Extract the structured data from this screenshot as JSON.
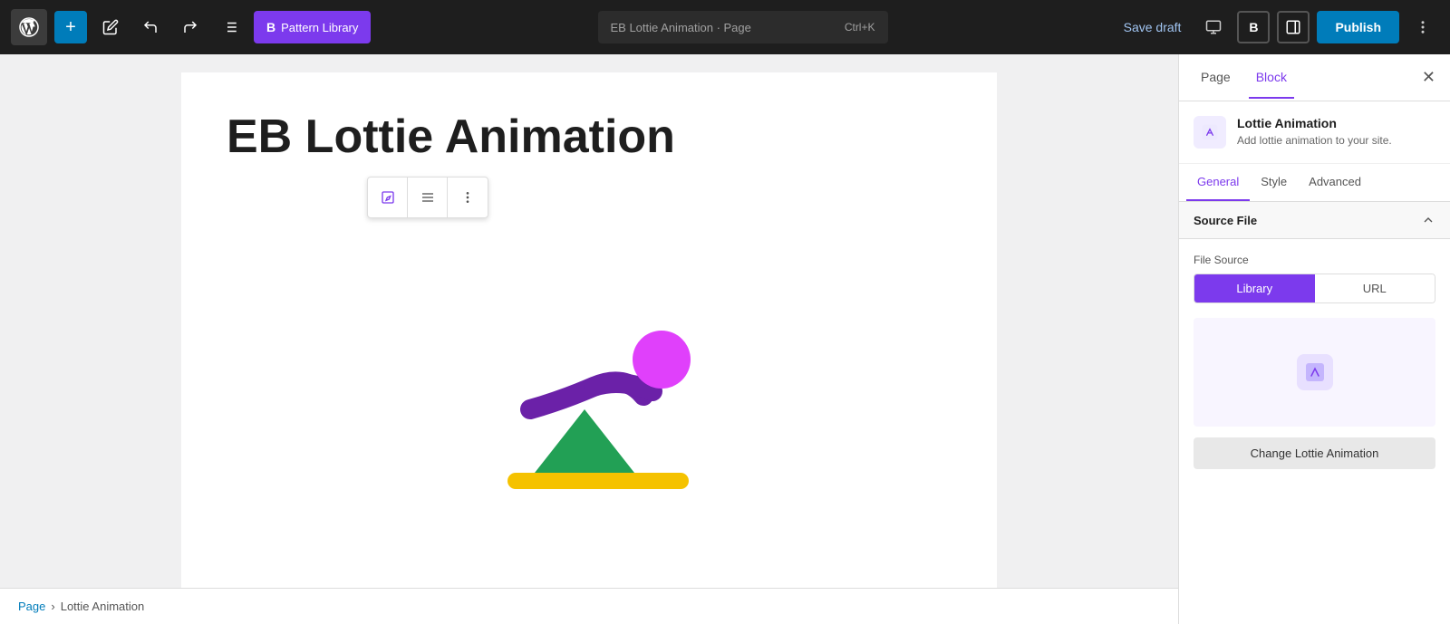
{
  "toolbar": {
    "add_label": "+",
    "pattern_library_label": "Pattern Library",
    "search_placeholder": "EB Lottie Animation · Page",
    "search_shortcut": "Ctrl+K",
    "save_draft_label": "Save draft",
    "publish_label": "Publish",
    "more_options_label": "Options"
  },
  "editor": {
    "page_title": "EB Lottie Animation"
  },
  "block_toolbar": {
    "edit_icon": "✏",
    "align_icon": "≡",
    "more_icon": "⋮"
  },
  "sidebar": {
    "page_tab": "Page",
    "block_tab": "Block",
    "close_label": "×",
    "block_info": {
      "title": "Lottie Animation",
      "description": "Add lottie animation to your site."
    },
    "settings_tabs": {
      "general": "General",
      "style": "Style",
      "advanced": "Advanced"
    },
    "source_file": {
      "title": "Source File",
      "file_source_label": "File Source",
      "library_option": "Library",
      "url_option": "URL",
      "change_button": "Change Lottie Animation"
    }
  },
  "breadcrumb": {
    "page_label": "Page",
    "separator": "›",
    "block_label": "Lottie Animation"
  },
  "colors": {
    "purple": "#7c3aed",
    "blue": "#007cba",
    "dark": "#1e1e1e"
  }
}
